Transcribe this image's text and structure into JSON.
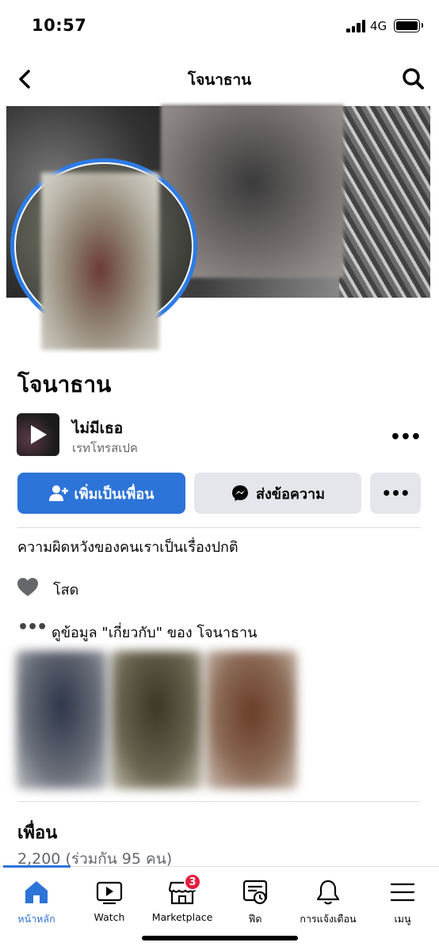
{
  "status_bar": {
    "time": "10:57",
    "network": "4G"
  },
  "nav": {
    "title": "โจนาธาน"
  },
  "profile": {
    "name": "โจนาธาน",
    "music_title": "ไม่มีเธอ",
    "music_artist": "เรทโทรสเปค",
    "bio": "ความผิดหวังของคนเราเป็นเรื่องปกติ",
    "relationship": "โสด",
    "about_link": "ดูข้อมูล \"เกี่ยวกับ\" ของ โจนาธาน"
  },
  "actions": {
    "add_friend": "เพิ่มเป็นเพื่อน",
    "message": "ส่งข้อความ",
    "more": "•••"
  },
  "friends": {
    "title": "เพื่อน",
    "count": "2,200",
    "mutual": " (ร่วมกัน 95 คน)"
  },
  "tabs": [
    {
      "label": "หน้าหลัก",
      "icon": "home-icon",
      "active": true
    },
    {
      "label": "Watch",
      "icon": "watch-icon"
    },
    {
      "label": "Marketplace",
      "icon": "marketplace-icon",
      "badge": "3"
    },
    {
      "label": "ฟีด",
      "icon": "feed-icon"
    },
    {
      "label": "การแจ้งเตือน",
      "icon": "bell-icon"
    },
    {
      "label": "เมนู",
      "icon": "menu-icon"
    }
  ],
  "colors": {
    "accent": "#2d74d8",
    "badge": "#e41e3f",
    "secondary_text": "#65676b"
  }
}
